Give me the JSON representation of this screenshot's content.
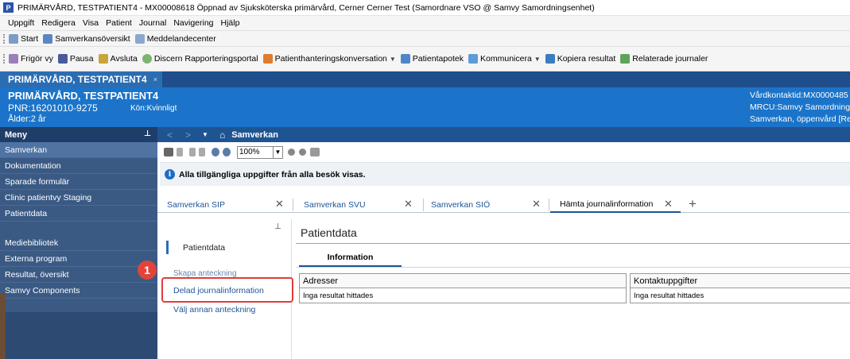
{
  "window": {
    "title": "PRIMÄRVÅRD, TESTPATIENT4 - MX00008618 Öppnad av Sjuksköterska primärvård, Cerner Cerner Test (Samordnare VSO @ Samvy Samordningsenhet)",
    "logo_letter": "P"
  },
  "menubar": [
    "Uppgift",
    "Redigera",
    "Visa",
    "Patient",
    "Journal",
    "Navigering",
    "Hjälp"
  ],
  "toolbar1": [
    {
      "label": "Start",
      "icon": "home-icon"
    },
    {
      "label": "Samverkansöversikt",
      "icon": "grid-icon"
    },
    {
      "label": "Meddelandecenter",
      "icon": "mail-icon"
    }
  ],
  "toolbar2": [
    {
      "label": "Frigör vy",
      "icon": "unlock-icon"
    },
    {
      "label": "Pausa",
      "icon": "pause-icon"
    },
    {
      "label": "Avsluta",
      "icon": "exit-icon"
    },
    {
      "label": "Discern Rapporteringsportal",
      "icon": "globe-icon"
    },
    {
      "label": "Patienthanteringskonversation",
      "icon": "person-icon"
    },
    {
      "label": "Patientapotek",
      "icon": "pill-icon"
    },
    {
      "label": "Kommunicera",
      "icon": "envelope-icon"
    },
    {
      "label": "Kopiera resultat",
      "icon": "copy-icon"
    },
    {
      "label": "Relaterade journaler",
      "icon": "docs-icon"
    }
  ],
  "patient_tab": {
    "label": "PRIMÄRVÅRD, TESTPATIENT4",
    "close": "×"
  },
  "banner": {
    "name": "PRIMÄRVÅRD, TESTPATIENT4",
    "pnr": "PNR:16201010-9275",
    "kon": "Kön:Kvinnligt",
    "alder": "Ålder:2 år",
    "right1": "Vårdkontaktid:MX0000485",
    "right2": "MRCU:Samvy Samordning:",
    "right3": "Samverkan, öppenvård [Re"
  },
  "leftnav": {
    "header": "Meny",
    "items_top": [
      "Samverkan",
      "Dokumentation",
      "Sparade formulär",
      "Clinic patientvy Staging",
      "Patientdata"
    ],
    "items_bottom": [
      "Mediebibliotek",
      "Externa program",
      "Resultat, översikt",
      "Samvy Components"
    ]
  },
  "content": {
    "nav_title": "Samverkan",
    "zoom": "100%",
    "info_text": "Alla tillgängliga uppgifter från alla besök visas.",
    "tabs": [
      "Samverkan SIP",
      "Samverkan SVU",
      "Samverkan SIÖ",
      "Hämta journalinformation"
    ],
    "subnav": {
      "title": "Patientdata",
      "items": [
        "Skapa anteckning",
        "Delad journalinformation",
        "Välj annan anteckning"
      ],
      "badge": "1"
    },
    "main": {
      "heading": "Patientdata",
      "inner_tab": "Information",
      "tables": [
        {
          "header": "Adresser",
          "empty": "Inga resultat hittades"
        },
        {
          "header": "Kontaktuppgifter",
          "empty": "Inga resultat hittades"
        }
      ]
    }
  }
}
